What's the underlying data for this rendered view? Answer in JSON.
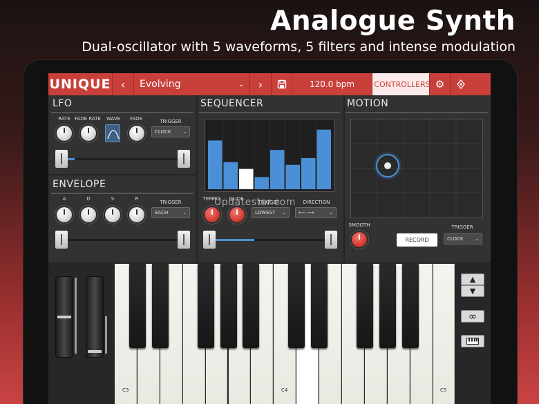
{
  "headline": {
    "title": "Analogue Synth",
    "subtitle": "Dual-oscillator with 5 waveforms, 5 filters and intense modulation"
  },
  "topbar": {
    "logo": "UNIQUE",
    "preset_name": "Evolving",
    "tempo": "120.0 bpm",
    "controllers_label": "CONTROLLERS"
  },
  "lfo": {
    "title": "LFO",
    "rate_label": "RATE",
    "fade_rate_label": "FADE RATE",
    "wave_label": "WAVE",
    "fade_label": "FADE",
    "trigger_label": "TRIGGER",
    "trigger_value": "CLOCK",
    "slider_value": 0.06
  },
  "envelope": {
    "title": "ENVELOPE",
    "a_label": "A",
    "d_label": "D",
    "s_label": "S",
    "r_label": "R",
    "trigger_label": "TRIGGER",
    "trigger_value": "EACH"
  },
  "sequencer": {
    "title": "SEQUENCER",
    "tempo_label": "TEMPO",
    "glide_label": "GLIDE",
    "trigger_label": "TRIGGER",
    "trigger_value": "LOWEST",
    "direction_label": "DIRECTION",
    "direction_value": "⟵ ⟶",
    "steps": [
      0.72,
      0.4,
      0.3,
      0.18,
      0.58,
      0.36,
      0.46,
      0.88
    ],
    "active_step": 2,
    "slider_value": 0.35
  },
  "motion": {
    "title": "MOTION",
    "smooth_label": "SMOOTH",
    "record_label": "RECORD",
    "trigger_label": "TRIGGER",
    "trigger_value": "CLOCK"
  },
  "keyboard": {
    "labels": [
      "C3",
      "C4",
      "C5"
    ]
  },
  "watermark": "Updatestar.com",
  "colors": {
    "accent": "#c9403b",
    "step_blue": "#4b8fd6",
    "panel": "#323232"
  }
}
